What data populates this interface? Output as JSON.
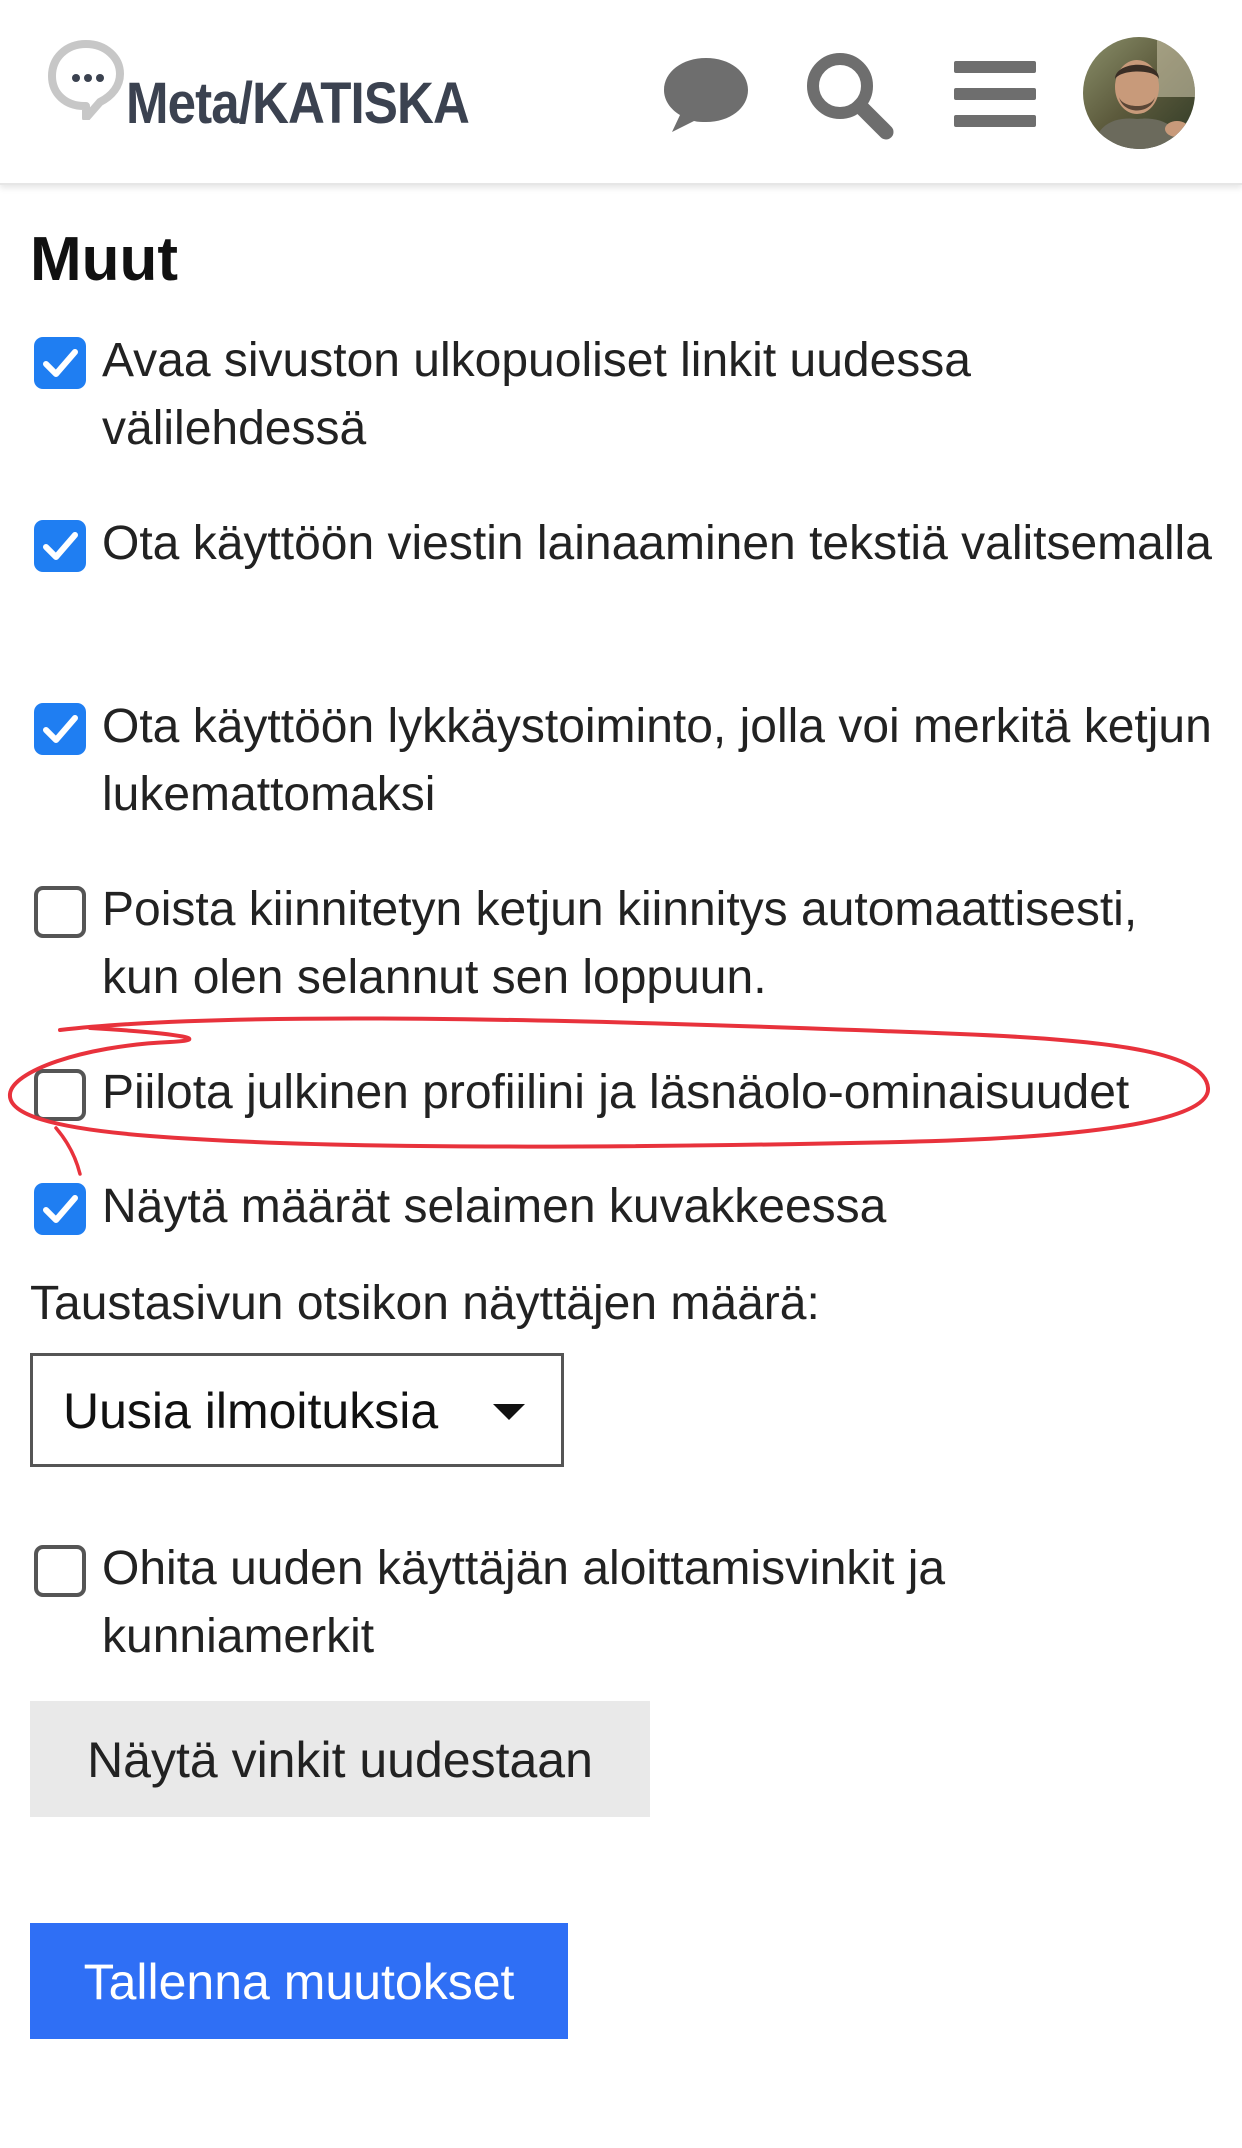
{
  "header": {
    "site_name": "Meta/KATISKA",
    "icons": [
      "chat-bubble-icon",
      "search-icon",
      "hamburger-menu-icon"
    ],
    "avatar": "user-avatar"
  },
  "section": {
    "title": "Muut"
  },
  "options": [
    {
      "label": "Avaa sivuston ulkopuoliset linkit uudessa välilehdessä",
      "checked": true
    },
    {
      "label": "Ota käyttöön viestin lainaaminen tekstiä valitsemalla",
      "checked": true
    },
    {
      "label": "Ota käyttöön lykkäystoiminto, jolla voi merkitä ketjun lukemattomaksi",
      "checked": true
    },
    {
      "label": "Poista kiinnitetyn ketjun kiinnitys automaattisesti, kun olen selannut sen loppuun.",
      "checked": false
    },
    {
      "label": "Piilota julkinen profiilini ja läsnäolo-ominaisuudet",
      "checked": false
    },
    {
      "label": "Näytä määrät selaimen kuvakkeessa",
      "checked": true
    }
  ],
  "dropdown": {
    "label": "Taustasivun otsikon näyttäjen määrä:",
    "value": "Uusia ilmoituksia"
  },
  "option_skip": {
    "label": "Ohita uuden käyttäjän aloittamisvinkit ja kunniamerkit",
    "checked": false
  },
  "buttons": {
    "show_tips": "Näytä vinkit uudestaan",
    "save": "Tallenna muutokset"
  },
  "colors": {
    "accent": "#1f7ef2",
    "primary_button": "#2f6ff5",
    "annotation": "#e8323c"
  }
}
